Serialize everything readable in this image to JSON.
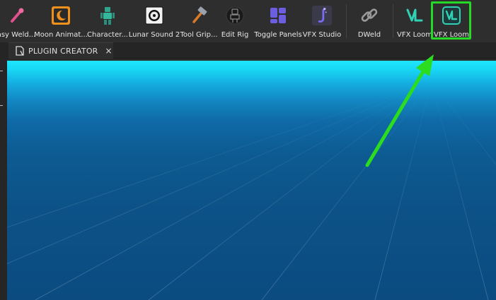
{
  "toolbar": {
    "items": [
      {
        "label": "asy Weld...",
        "icon": "pink-wand-icon"
      },
      {
        "label": "Moon Animat...",
        "icon": "moon-icon"
      },
      {
        "label": "Character...",
        "icon": "character-icon"
      },
      {
        "label": "Lunar Sound 2",
        "icon": "sound-icon"
      },
      {
        "label": "Tool Grip...",
        "icon": "hammer-icon"
      },
      {
        "label": "Edit Rig",
        "icon": "rig-icon"
      },
      {
        "label": "Toggle Panels",
        "icon": "panels-icon"
      },
      {
        "label": "VFX Studio",
        "icon": "vfx-studio-icon"
      },
      {
        "label": "DWeld",
        "icon": "chain-link-icon"
      },
      {
        "label": "VFX Loom",
        "icon": "vfx-loom-icon"
      },
      {
        "label": "VFX Loom",
        "icon": "vfx-loom-icon"
      }
    ]
  },
  "tabs": [
    {
      "label": "PLUGIN CREATOR",
      "close": "×"
    }
  ],
  "colors": {
    "highlight": "#27d927",
    "arrow": "#2bdc1f",
    "viewport_top": "#1fe6ff",
    "viewport_bottom": "#0b4b80"
  }
}
